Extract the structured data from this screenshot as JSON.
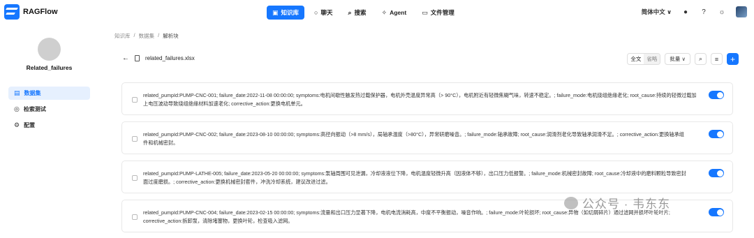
{
  "app": {
    "name": "RAGFlow"
  },
  "nav": [
    {
      "icon": "kb-icon",
      "label": "知识库",
      "active": true
    },
    {
      "icon": "chat-icon",
      "label": "聊天",
      "active": false
    },
    {
      "icon": "search-icon",
      "label": "搜索",
      "active": false
    },
    {
      "icon": "agent-icon",
      "label": "Agent",
      "active": false
    },
    {
      "icon": "folder-icon",
      "label": "文件管理",
      "active": false
    }
  ],
  "topright": {
    "language": "简体中文 ∨"
  },
  "breadcrumb": {
    "root": "知识库",
    "dataset": "数据集",
    "current": "解析块",
    "sep": "/"
  },
  "sidebar": {
    "kb_name": "Related_failures",
    "items": [
      {
        "label": "数据集",
        "icon": "dataset-icon",
        "active": true
      },
      {
        "label": "检索测试",
        "icon": "retrieval-test-icon",
        "active": false
      },
      {
        "label": "配置",
        "icon": "gear-icon",
        "active": false
      }
    ]
  },
  "file": {
    "name": "related_failures.xlsx"
  },
  "toolbar": {
    "full_label": "全文",
    "omit_label": "省略",
    "batch_label": "批量 ∨"
  },
  "chunks": [
    {
      "line1": "related_pumpId:PUMP-CNC-001; failure_date:2022-11-08 00:00:00; symptoms:电机间歇性触发热过载保护器，电机外壳温度异常高（> 90°C），电机附近有轻微焦糊气味，转速不稳定。; failure_mode:电机绕组绝缘老化; root_cause:持续的轻微过载加",
      "line2": "上电压波动导致绕组绝缘材料加速老化; corrective_action:更换电机单元。",
      "enabled": true
    },
    {
      "line1": "related_pumpId:PUMP-CNC-002; failure_date:2023-08-10 00:00:00; symptoms:高径向振动（>8 mm/s），局轴承温度（>80°C），异常研磨噪音。; failure_mode:轴承故障; root_cause:润滑剂老化导致轴承润滑不足。; corrective_action:更换轴承组",
      "line2": "件和机械密封。",
      "enabled": true
    },
    {
      "line1": "related_pumpId:PUMP-LATHE-005; failure_date:2023-05-20 00:00:00; symptoms:泵轴周围可见泄漏，冷却液液位下降，电机温度轻微升高（因液体不够），出口压力低报警。; failure_mode:机械密封故障; root_cause:冷却液中的磨料颗粒导致密封",
      "line2": "面过度磨损。; corrective_action:更换机械密封套件，冲洗冷却系统，建议改进过滤。",
      "enabled": true
    },
    {
      "line1": "related_pumpId:PUMP-CNC-004; failure_date:2023-02-15 00:00:00; symptoms:流量和出口压力显著下降，电机电流消耗高，中度不平衡振动，噪音作响。; failure_mode:叶轮损坏; root_cause:异物（如切屑碎片）通过滤网并损坏叶轮叶片;",
      "line2": "corrective_action:拆卸泵，清除堵塞物，更换叶轮，检查吸入滤网。",
      "enabled": true
    }
  ],
  "watermark": {
    "text": "公众号 · 韦东东"
  },
  "colors": {
    "accent": "#1677ff"
  }
}
